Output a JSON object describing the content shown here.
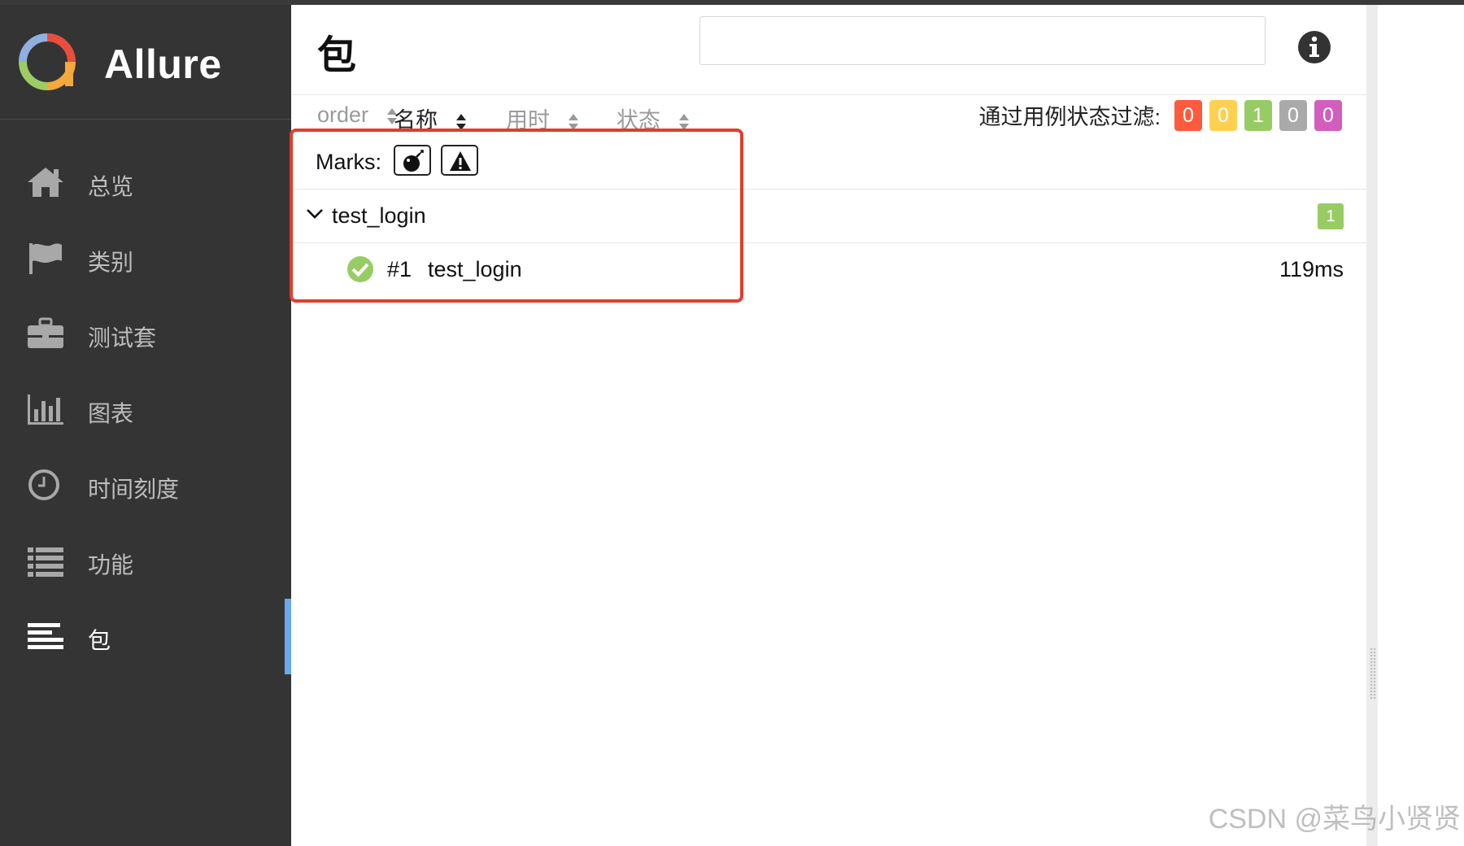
{
  "brand": {
    "name": "Allure"
  },
  "sidebar": {
    "items": [
      {
        "label": "总览",
        "icon": "home-icon",
        "active": false
      },
      {
        "label": "类别",
        "icon": "flag-icon",
        "active": false
      },
      {
        "label": "测试套",
        "icon": "briefcase-icon",
        "active": false
      },
      {
        "label": "图表",
        "icon": "bar-chart-icon",
        "active": false
      },
      {
        "label": "时间刻度",
        "icon": "clock-icon",
        "active": false
      },
      {
        "label": "功能",
        "icon": "list-icon",
        "active": false
      },
      {
        "label": "包",
        "icon": "align-left-icon",
        "active": true
      }
    ],
    "active_color": "#6aa8f0"
  },
  "header": {
    "title": "包",
    "search": {
      "value": "",
      "placeholder": ""
    },
    "info_icon": "info-icon"
  },
  "columns": [
    {
      "label": "order",
      "active": false
    },
    {
      "label": "名称",
      "active": true
    },
    {
      "label": "用时",
      "active": false
    },
    {
      "label": "状态",
      "active": false
    }
  ],
  "filter": {
    "label": "通过用例状态过滤:",
    "badges": [
      {
        "status": "failed",
        "count": "0",
        "color": "#fd5a3e"
      },
      {
        "status": "broken",
        "count": "0",
        "color": "#ffd050"
      },
      {
        "status": "passed",
        "count": "1",
        "color": "#97cc64"
      },
      {
        "status": "skipped",
        "count": "0",
        "color": "#aaaaaa"
      },
      {
        "status": "unknown",
        "count": "0",
        "color": "#d35ebe"
      }
    ]
  },
  "marks": {
    "label": "Marks:",
    "toggles": [
      "bomb-icon",
      "warning-icon"
    ]
  },
  "tree": {
    "group": {
      "name": "test_login",
      "count": "1",
      "expanded": true
    },
    "tests": [
      {
        "order": "#1",
        "name": "test_login",
        "duration": "119ms",
        "status": "passed",
        "status_color": "#97cc64"
      }
    ]
  },
  "highlight_color": "#e23c2c",
  "watermark": "CSDN @菜鸟小贤贤"
}
